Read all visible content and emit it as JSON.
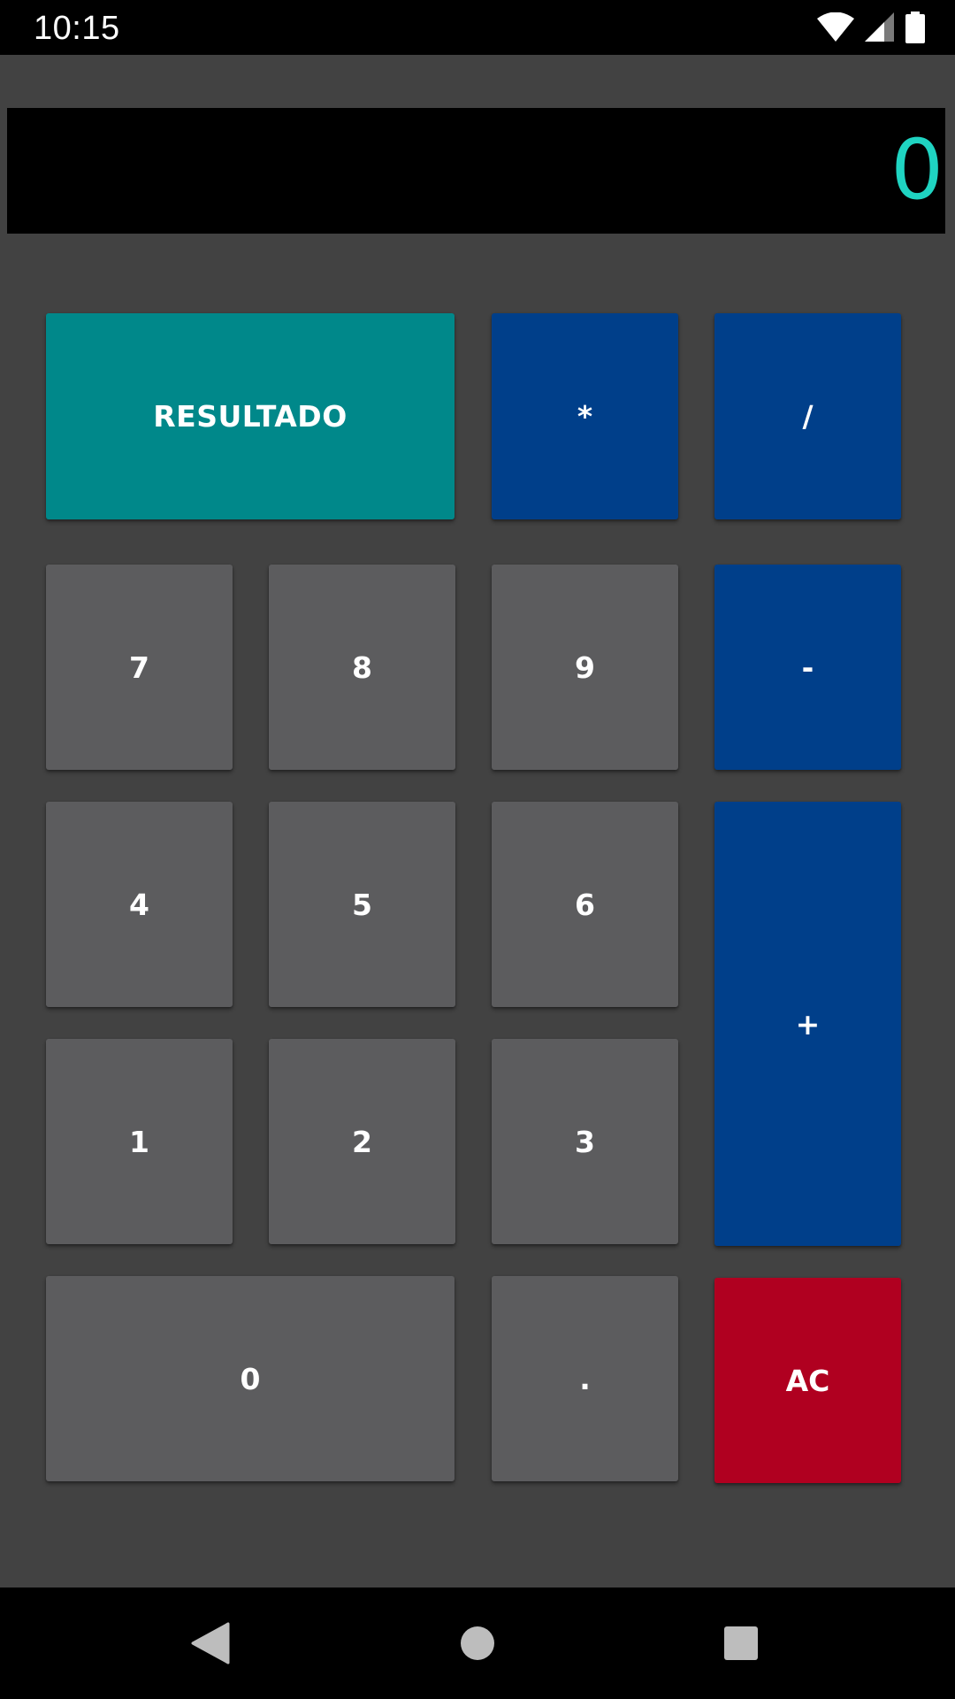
{
  "status_bar": {
    "time": "10:15",
    "icons": [
      "wifi-icon",
      "cellular-signal-icon",
      "battery-icon"
    ]
  },
  "display": {
    "value": "0",
    "color": "#1fd4c2"
  },
  "buttons": {
    "result": "RESULTADO",
    "multiply": "*",
    "divide": "/",
    "seven": "7",
    "eight": "8",
    "nine": "9",
    "minus": "-",
    "four": "4",
    "five": "5",
    "six": "6",
    "plus": "+",
    "one": "1",
    "two": "2",
    "three": "3",
    "zero": "0",
    "decimal": ".",
    "clear": "AC"
  },
  "colors": {
    "background": "#424242",
    "digit_button": "#5c5c5e",
    "operator_button": "#003f8a",
    "result_button": "#00888a",
    "clear_button": "#b00020"
  },
  "nav_bar": {
    "icons": [
      "back-icon",
      "home-icon",
      "recents-icon"
    ]
  }
}
